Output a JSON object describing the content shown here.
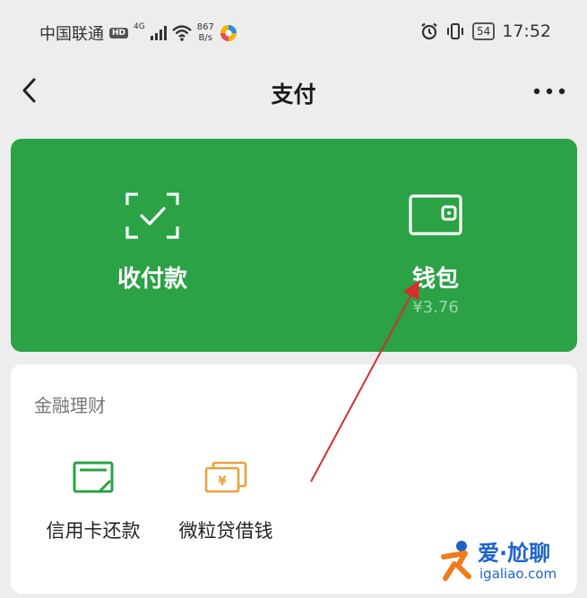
{
  "status_bar": {
    "carrier": "中国联通",
    "hd": "HD",
    "signal_type": "4G",
    "speed_value": "867",
    "speed_unit": "B/s",
    "battery": "54",
    "time": "17:52"
  },
  "nav": {
    "title": "支付"
  },
  "pay_card": {
    "items": [
      {
        "label": "收付款",
        "icon": "scan-check-icon"
      },
      {
        "label": "钱包",
        "sub": "¥3.76",
        "icon": "wallet-icon"
      }
    ]
  },
  "finance": {
    "title": "金融理财",
    "items": [
      {
        "label": "信用卡还款",
        "icon": "credit-card-icon"
      },
      {
        "label": "微粒贷借钱",
        "icon": "money-bill-icon"
      }
    ]
  },
  "watermark": {
    "title": "爱·尬聊",
    "url": "igaliao.com"
  },
  "colors": {
    "green": "#2ba245",
    "finance_green": "#2ba245",
    "finance_orange": "#e8a23c",
    "arrow": "#d32f2f"
  }
}
